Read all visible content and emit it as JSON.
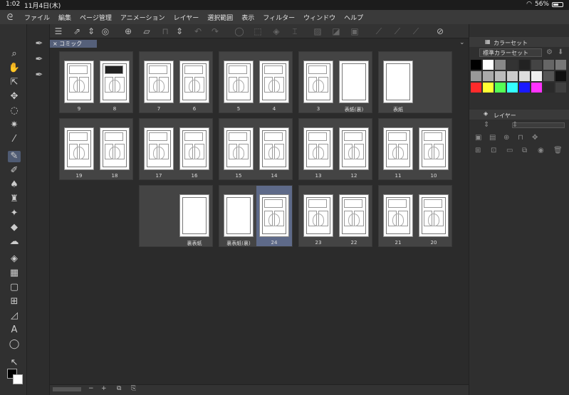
{
  "status": {
    "time": "1:02",
    "date": "11月4日(木)",
    "battery": "56%"
  },
  "menu": [
    "ファイル",
    "編集",
    "ページ管理",
    "アニメーション",
    "レイヤー",
    "選択範囲",
    "表示",
    "フィルター",
    "ウィンドウ",
    "ヘルプ"
  ],
  "tab": {
    "label": "コミック"
  },
  "pages": {
    "r1": [
      "9",
      "8",
      "7",
      "6",
      "5",
      "4",
      "3",
      "表紙(裏)",
      "表紙"
    ],
    "r2": [
      "19",
      "18",
      "17",
      "16",
      "15",
      "14",
      "13",
      "12",
      "11",
      "10"
    ],
    "r3": [
      "裏表紙",
      "裏表紙(裏)",
      "24",
      "23",
      "22",
      "21",
      "20"
    ]
  },
  "right": {
    "color_set_tab": "カラーセット",
    "color_set_name": "標準カラーセット",
    "layer_tab": "レイヤー",
    "colors": [
      "#000000",
      "#ffffff",
      "#888888",
      "#333333",
      "#222222",
      "#444444",
      "#666666",
      "#777777",
      "#999999",
      "#aaaaaa",
      "#bbbbbb",
      "#cccccc",
      "#dddddd",
      "#eeeeee",
      "#555555",
      "#111111",
      "#ff2b2b",
      "#ffff33",
      "#55ff55",
      "#33ffff",
      "#1a1aff",
      "#ff33ff",
      "#2a2a2a",
      "#404040"
    ]
  }
}
